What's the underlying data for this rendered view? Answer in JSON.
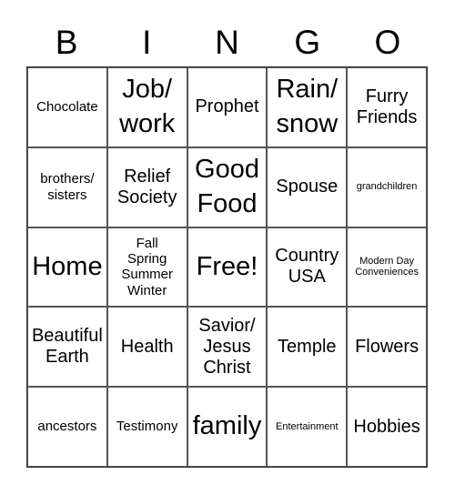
{
  "header": {
    "letters": [
      "B",
      "I",
      "N",
      "G",
      "O"
    ]
  },
  "cells": [
    {
      "text": "Chocolate",
      "size": "sm"
    },
    {
      "text": "Job/\nwork",
      "size": "lg"
    },
    {
      "text": "Prophet",
      "size": "md"
    },
    {
      "text": "Rain/\nsnow",
      "size": "lg"
    },
    {
      "text": "Furry\nFriends",
      "size": "md"
    },
    {
      "text": "brothers/\nsisters",
      "size": "sm"
    },
    {
      "text": "Relief\nSociety",
      "size": "md"
    },
    {
      "text": "Good\nFood",
      "size": "lg"
    },
    {
      "text": "Spouse",
      "size": "md"
    },
    {
      "text": "grandchildren",
      "size": "xs"
    },
    {
      "text": "Home",
      "size": "lg"
    },
    {
      "text": "Fall\nSpring\nSummer\nWinter",
      "size": "sm"
    },
    {
      "text": "Free!",
      "size": "lg"
    },
    {
      "text": "Country\nUSA",
      "size": "md"
    },
    {
      "text": "Modern Day\nConveniences",
      "size": "xs"
    },
    {
      "text": "Beautiful\nEarth",
      "size": "md"
    },
    {
      "text": "Health",
      "size": "md"
    },
    {
      "text": "Savior/\nJesus\nChrist",
      "size": "md"
    },
    {
      "text": "Temple",
      "size": "md"
    },
    {
      "text": "Flowers",
      "size": "md"
    },
    {
      "text": "ancestors",
      "size": "sm"
    },
    {
      "text": "Testimony",
      "size": "sm"
    },
    {
      "text": "family",
      "size": "lg"
    },
    {
      "text": "Entertainment",
      "size": "xs"
    },
    {
      "text": "Hobbies",
      "size": "md"
    }
  ]
}
